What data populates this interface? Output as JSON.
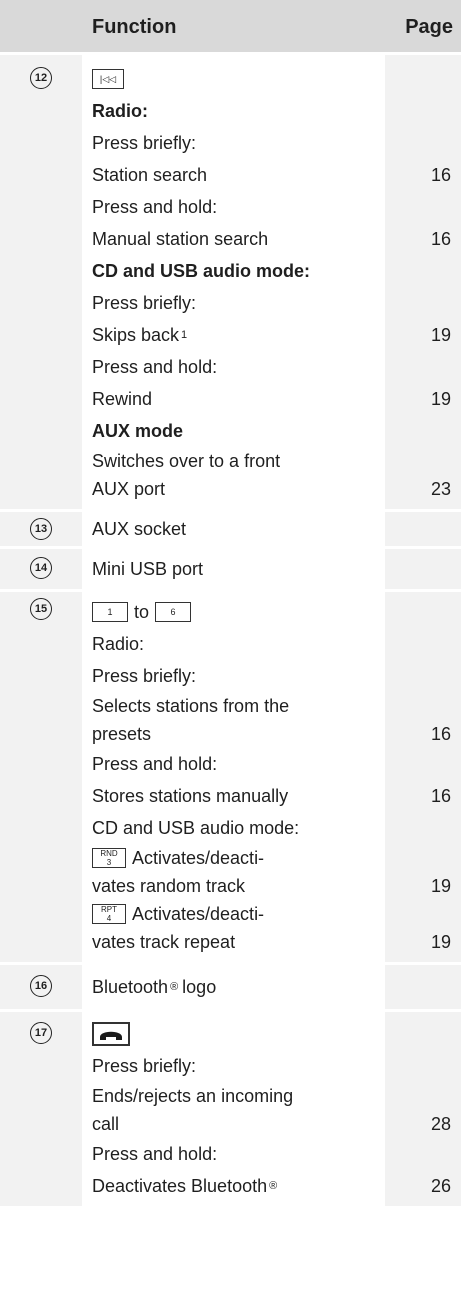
{
  "header": {
    "function": "Function",
    "page": "Page"
  },
  "rows": [
    {
      "num": "12",
      "skip_key": "|◁◁",
      "radio": "Radio:",
      "press_briefly_1": "Press briefly:",
      "station_search": "Station search",
      "station_search_page": "16",
      "press_hold_1": "Press and hold:",
      "manual_station_search": "Manual station search",
      "manual_page": "16",
      "cd_usb": "CD and USB audio mode:",
      "press_briefly_2": "Press briefly:",
      "skips_back": "Skips back",
      "skips_back_note": "1",
      "skips_back_page": "19",
      "press_hold_2": "Press and hold:",
      "rewind": "Rewind",
      "rewind_page": "19",
      "aux_mode": "AUX mode",
      "switches_line1": "Switches over to a front",
      "switches_line2": "AUX port",
      "switches_page": "23"
    },
    {
      "num": "13",
      "text": "AUX socket"
    },
    {
      "num": "14",
      "text": "Mini USB port"
    },
    {
      "num": "15",
      "key1": "1",
      "to": "to",
      "key6": "6",
      "radio": "Radio:",
      "press_briefly": "Press briefly:",
      "selects_line1": "Selects stations from the",
      "selects_line2": "presets",
      "selects_page": "16",
      "press_hold": "Press and hold:",
      "stores": "Stores stations manually",
      "stores_page": "16",
      "cd_usb": "CD and USB audio mode:",
      "rnd_top": "RND",
      "rnd_num": "3",
      "random_line1": "Activates/deacti-",
      "random_line2": "vates random track",
      "random_page": "19",
      "rpt_top": "RPT",
      "rpt_num": "4",
      "repeat_line1": "Activates/deacti-",
      "repeat_line2": "vates track repeat",
      "repeat_page": "19"
    },
    {
      "num": "16",
      "text": "Bluetooth",
      "reg": "®",
      "text2": "logo"
    },
    {
      "num": "17",
      "press_briefly": "Press briefly:",
      "ends_line1": "Ends/rejects an incoming",
      "ends_line2": "call",
      "ends_page": "28",
      "press_hold": "Press and hold:",
      "deactivates": "Deactivates Bluetooth",
      "deactivates_reg": "®",
      "deactivates_page": "26"
    }
  ],
  "icons": {
    "phone_key": "phone-handset-icon"
  }
}
